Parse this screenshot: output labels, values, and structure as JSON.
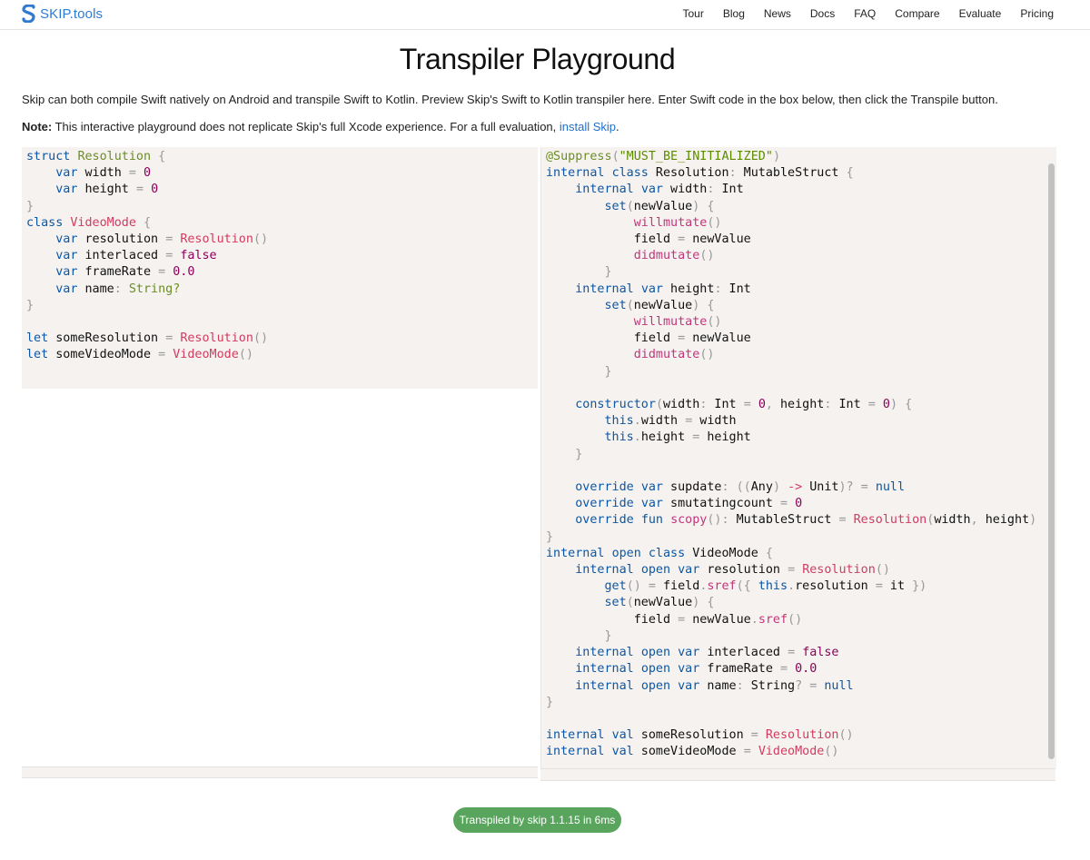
{
  "header": {
    "brand": "SKIP.tools",
    "nav": [
      "Tour",
      "Blog",
      "News",
      "Docs",
      "FAQ",
      "Compare",
      "Evaluate",
      "Pricing"
    ]
  },
  "page_title": "Transpiler Playground",
  "intro": "Skip can both compile Swift natively on Android and transpile Swift to Kotlin. Preview Skip's Swift to Kotlin transpiler here. Enter Swift code in the box below, then click the Transpile button.",
  "note": {
    "label": "Note:",
    "text": " This interactive playground does not replicate Skip's full Xcode experience. For a full evaluation, ",
    "link": "install Skip",
    "tail": "."
  },
  "swift_code": [
    [
      [
        "kw",
        "struct"
      ],
      [
        "t",
        " "
      ],
      [
        "type",
        "Resolution"
      ],
      [
        "t",
        " "
      ],
      [
        "punc",
        "{"
      ]
    ],
    [
      [
        "t",
        "    "
      ],
      [
        "kw",
        "var"
      ],
      [
        "t",
        " width "
      ],
      [
        "punc",
        "="
      ],
      [
        "t",
        " "
      ],
      [
        "num",
        "0"
      ]
    ],
    [
      [
        "t",
        "    "
      ],
      [
        "kw",
        "var"
      ],
      [
        "t",
        " height "
      ],
      [
        "punc",
        "="
      ],
      [
        "t",
        " "
      ],
      [
        "num",
        "0"
      ]
    ],
    [
      [
        "punc",
        "}"
      ]
    ],
    [
      [
        "kw",
        "class"
      ],
      [
        "t",
        " "
      ],
      [
        "cls",
        "VideoMode"
      ],
      [
        "t",
        " "
      ],
      [
        "punc",
        "{"
      ]
    ],
    [
      [
        "t",
        "    "
      ],
      [
        "kw",
        "var"
      ],
      [
        "t",
        " resolution "
      ],
      [
        "punc",
        "="
      ],
      [
        "t",
        " "
      ],
      [
        "cls",
        "Resolution"
      ],
      [
        "punc",
        "()"
      ]
    ],
    [
      [
        "t",
        "    "
      ],
      [
        "kw",
        "var"
      ],
      [
        "t",
        " interlaced "
      ],
      [
        "punc",
        "="
      ],
      [
        "t",
        " "
      ],
      [
        "num",
        "false"
      ]
    ],
    [
      [
        "t",
        "    "
      ],
      [
        "kw",
        "var"
      ],
      [
        "t",
        " frameRate "
      ],
      [
        "punc",
        "="
      ],
      [
        "t",
        " "
      ],
      [
        "num",
        "0.0"
      ]
    ],
    [
      [
        "t",
        "    "
      ],
      [
        "kw",
        "var"
      ],
      [
        "t",
        " name"
      ],
      [
        "punc",
        ":"
      ],
      [
        "t",
        " "
      ],
      [
        "type",
        "String?"
      ]
    ],
    [
      [
        "punc",
        "}"
      ]
    ],
    [],
    [
      [
        "kw",
        "let"
      ],
      [
        "t",
        " someResolution "
      ],
      [
        "punc",
        "="
      ],
      [
        "t",
        " "
      ],
      [
        "cls",
        "Resolution"
      ],
      [
        "punc",
        "()"
      ]
    ],
    [
      [
        "kw",
        "let"
      ],
      [
        "t",
        " someVideoMode "
      ],
      [
        "punc",
        "="
      ],
      [
        "t",
        " "
      ],
      [
        "cls",
        "VideoMode"
      ],
      [
        "punc",
        "()"
      ]
    ]
  ],
  "kotlin_code": [
    [
      [
        "attr",
        "@Suppress"
      ],
      [
        "punc",
        "("
      ],
      [
        "str",
        "\"MUST_BE_INITIALIZED\""
      ],
      [
        "punc",
        ")"
      ]
    ],
    [
      [
        "kw",
        "internal"
      ],
      [
        "t",
        " "
      ],
      [
        "kw",
        "class"
      ],
      [
        "t",
        " Resolution"
      ],
      [
        "punc",
        ":"
      ],
      [
        "t",
        " MutableStruct "
      ],
      [
        "punc",
        "{"
      ]
    ],
    [
      [
        "t",
        "    "
      ],
      [
        "kw",
        "internal"
      ],
      [
        "t",
        " "
      ],
      [
        "kw",
        "var"
      ],
      [
        "t",
        " width"
      ],
      [
        "punc",
        ":"
      ],
      [
        "t",
        " Int"
      ]
    ],
    [
      [
        "t",
        "        "
      ],
      [
        "kw",
        "set"
      ],
      [
        "punc",
        "("
      ],
      [
        "t",
        "newValue"
      ],
      [
        "punc",
        ")"
      ],
      [
        "t",
        " "
      ],
      [
        "punc",
        "{"
      ]
    ],
    [
      [
        "t",
        "            "
      ],
      [
        "fn",
        "willmutate"
      ],
      [
        "punc",
        "()"
      ]
    ],
    [
      [
        "t",
        "            field "
      ],
      [
        "punc",
        "="
      ],
      [
        "t",
        " newValue"
      ]
    ],
    [
      [
        "t",
        "            "
      ],
      [
        "fn",
        "didmutate"
      ],
      [
        "punc",
        "()"
      ]
    ],
    [
      [
        "t",
        "        "
      ],
      [
        "punc",
        "}"
      ]
    ],
    [
      [
        "t",
        "    "
      ],
      [
        "kw",
        "internal"
      ],
      [
        "t",
        " "
      ],
      [
        "kw",
        "var"
      ],
      [
        "t",
        " height"
      ],
      [
        "punc",
        ":"
      ],
      [
        "t",
        " Int"
      ]
    ],
    [
      [
        "t",
        "        "
      ],
      [
        "kw",
        "set"
      ],
      [
        "punc",
        "("
      ],
      [
        "t",
        "newValue"
      ],
      [
        "punc",
        ")"
      ],
      [
        "t",
        " "
      ],
      [
        "punc",
        "{"
      ]
    ],
    [
      [
        "t",
        "            "
      ],
      [
        "fn",
        "willmutate"
      ],
      [
        "punc",
        "()"
      ]
    ],
    [
      [
        "t",
        "            field "
      ],
      [
        "punc",
        "="
      ],
      [
        "t",
        " newValue"
      ]
    ],
    [
      [
        "t",
        "            "
      ],
      [
        "fn",
        "didmutate"
      ],
      [
        "punc",
        "()"
      ]
    ],
    [
      [
        "t",
        "        "
      ],
      [
        "punc",
        "}"
      ]
    ],
    [],
    [
      [
        "t",
        "    "
      ],
      [
        "kw",
        "constructor"
      ],
      [
        "punc",
        "("
      ],
      [
        "t",
        "width"
      ],
      [
        "punc",
        ":"
      ],
      [
        "t",
        " Int "
      ],
      [
        "punc",
        "="
      ],
      [
        "t",
        " "
      ],
      [
        "num",
        "0"
      ],
      [
        "punc",
        ","
      ],
      [
        "t",
        " height"
      ],
      [
        "punc",
        ":"
      ],
      [
        "t",
        " Int "
      ],
      [
        "punc",
        "="
      ],
      [
        "t",
        " "
      ],
      [
        "num",
        "0"
      ],
      [
        "punc",
        ")"
      ],
      [
        "t",
        " "
      ],
      [
        "punc",
        "{"
      ]
    ],
    [
      [
        "t",
        "        "
      ],
      [
        "kw",
        "this"
      ],
      [
        "punc",
        "."
      ],
      [
        "t",
        "width "
      ],
      [
        "punc",
        "="
      ],
      [
        "t",
        " width"
      ]
    ],
    [
      [
        "t",
        "        "
      ],
      [
        "kw",
        "this"
      ],
      [
        "punc",
        "."
      ],
      [
        "t",
        "height "
      ],
      [
        "punc",
        "="
      ],
      [
        "t",
        " height"
      ]
    ],
    [
      [
        "t",
        "    "
      ],
      [
        "punc",
        "}"
      ]
    ],
    [],
    [
      [
        "t",
        "    "
      ],
      [
        "kw",
        "override"
      ],
      [
        "t",
        " "
      ],
      [
        "kw",
        "var"
      ],
      [
        "t",
        " supdate"
      ],
      [
        "punc",
        ":"
      ],
      [
        "t",
        " "
      ],
      [
        "punc",
        "(("
      ],
      [
        "t",
        "Any"
      ],
      [
        "punc",
        ")"
      ],
      [
        "t",
        " "
      ],
      [
        "cls",
        "->"
      ],
      [
        "t",
        " Unit"
      ],
      [
        "punc",
        ")?"
      ],
      [
        "t",
        " "
      ],
      [
        "punc",
        "="
      ],
      [
        "t",
        " "
      ],
      [
        "kw",
        "null"
      ]
    ],
    [
      [
        "t",
        "    "
      ],
      [
        "kw",
        "override"
      ],
      [
        "t",
        " "
      ],
      [
        "kw",
        "var"
      ],
      [
        "t",
        " smutatingcount "
      ],
      [
        "punc",
        "="
      ],
      [
        "t",
        " "
      ],
      [
        "num",
        "0"
      ]
    ],
    [
      [
        "t",
        "    "
      ],
      [
        "kw",
        "override"
      ],
      [
        "t",
        " "
      ],
      [
        "kw",
        "fun"
      ],
      [
        "t",
        " "
      ],
      [
        "fn",
        "scopy"
      ],
      [
        "punc",
        "():"
      ],
      [
        "t",
        " MutableStruct "
      ],
      [
        "punc",
        "="
      ],
      [
        "t",
        " "
      ],
      [
        "cls",
        "Resolution"
      ],
      [
        "punc",
        "("
      ],
      [
        "t",
        "width"
      ],
      [
        "punc",
        ","
      ],
      [
        "t",
        " height"
      ],
      [
        "punc",
        ")"
      ]
    ],
    [
      [
        "punc",
        "}"
      ]
    ],
    [
      [
        "kw",
        "internal"
      ],
      [
        "t",
        " "
      ],
      [
        "kw",
        "open"
      ],
      [
        "t",
        " "
      ],
      [
        "kw",
        "class"
      ],
      [
        "t",
        " VideoMode "
      ],
      [
        "punc",
        "{"
      ]
    ],
    [
      [
        "t",
        "    "
      ],
      [
        "kw",
        "internal"
      ],
      [
        "t",
        " "
      ],
      [
        "kw",
        "open"
      ],
      [
        "t",
        " "
      ],
      [
        "kw",
        "var"
      ],
      [
        "t",
        " resolution "
      ],
      [
        "punc",
        "="
      ],
      [
        "t",
        " "
      ],
      [
        "cls",
        "Resolution"
      ],
      [
        "punc",
        "()"
      ]
    ],
    [
      [
        "t",
        "        "
      ],
      [
        "kw",
        "get"
      ],
      [
        "punc",
        "()"
      ],
      [
        "t",
        " "
      ],
      [
        "punc",
        "="
      ],
      [
        "t",
        " field"
      ],
      [
        "punc",
        "."
      ],
      [
        "fn",
        "sref"
      ],
      [
        "punc",
        "({"
      ],
      [
        "t",
        " "
      ],
      [
        "kw",
        "this"
      ],
      [
        "punc",
        "."
      ],
      [
        "t",
        "resolution "
      ],
      [
        "punc",
        "="
      ],
      [
        "t",
        " it "
      ],
      [
        "punc",
        "})"
      ]
    ],
    [
      [
        "t",
        "        "
      ],
      [
        "kw",
        "set"
      ],
      [
        "punc",
        "("
      ],
      [
        "t",
        "newValue"
      ],
      [
        "punc",
        ")"
      ],
      [
        "t",
        " "
      ],
      [
        "punc",
        "{"
      ]
    ],
    [
      [
        "t",
        "            field "
      ],
      [
        "punc",
        "="
      ],
      [
        "t",
        " newValue"
      ],
      [
        "punc",
        "."
      ],
      [
        "fn",
        "sref"
      ],
      [
        "punc",
        "()"
      ]
    ],
    [
      [
        "t",
        "        "
      ],
      [
        "punc",
        "}"
      ]
    ],
    [
      [
        "t",
        "    "
      ],
      [
        "kw",
        "internal"
      ],
      [
        "t",
        " "
      ],
      [
        "kw",
        "open"
      ],
      [
        "t",
        " "
      ],
      [
        "kw",
        "var"
      ],
      [
        "t",
        " interlaced "
      ],
      [
        "punc",
        "="
      ],
      [
        "t",
        " "
      ],
      [
        "num",
        "false"
      ]
    ],
    [
      [
        "t",
        "    "
      ],
      [
        "kw",
        "internal"
      ],
      [
        "t",
        " "
      ],
      [
        "kw",
        "open"
      ],
      [
        "t",
        " "
      ],
      [
        "kw",
        "var"
      ],
      [
        "t",
        " frameRate "
      ],
      [
        "punc",
        "="
      ],
      [
        "t",
        " "
      ],
      [
        "num",
        "0.0"
      ]
    ],
    [
      [
        "t",
        "    "
      ],
      [
        "kw",
        "internal"
      ],
      [
        "t",
        " "
      ],
      [
        "kw",
        "open"
      ],
      [
        "t",
        " "
      ],
      [
        "kw",
        "var"
      ],
      [
        "t",
        " name"
      ],
      [
        "punc",
        ":"
      ],
      [
        "t",
        " String"
      ],
      [
        "punc",
        "?"
      ],
      [
        "t",
        " "
      ],
      [
        "punc",
        "="
      ],
      [
        "t",
        " "
      ],
      [
        "kw",
        "null"
      ]
    ],
    [
      [
        "punc",
        "}"
      ]
    ],
    [],
    [
      [
        "kw",
        "internal"
      ],
      [
        "t",
        " "
      ],
      [
        "kw",
        "val"
      ],
      [
        "t",
        " someResolution "
      ],
      [
        "punc",
        "="
      ],
      [
        "t",
        " "
      ],
      [
        "cls",
        "Resolution"
      ],
      [
        "punc",
        "()"
      ]
    ],
    [
      [
        "kw",
        "internal"
      ],
      [
        "t",
        " "
      ],
      [
        "kw",
        "val"
      ],
      [
        "t",
        " someVideoMode "
      ],
      [
        "punc",
        "="
      ],
      [
        "t",
        " "
      ],
      [
        "cls",
        "VideoMode"
      ],
      [
        "punc",
        "()"
      ]
    ]
  ],
  "status": "Transpiled by skip 1.1.15 in 6ms"
}
